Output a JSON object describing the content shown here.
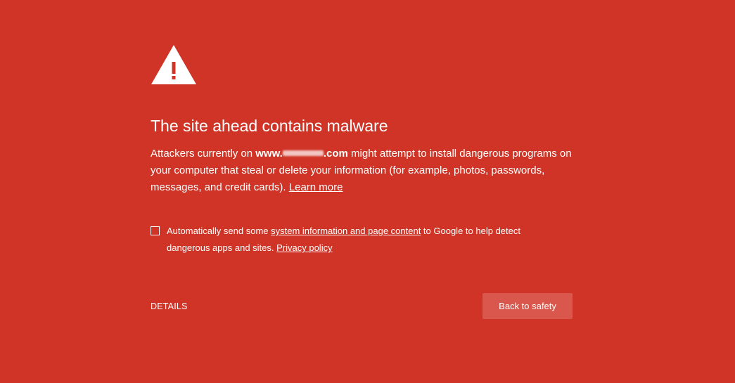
{
  "colors": {
    "background": "#cf3427",
    "button": "#d9574c",
    "text": "#ffffff"
  },
  "icon": "warning-triangle-icon",
  "heading": "The site ahead contains malware",
  "body": {
    "prefix": "Attackers currently on ",
    "domain_start": "www.",
    "domain_end": ".com",
    "suffix": " might attempt to install dangerous programs on your computer that steal or delete your information (for example, photos, passwords, messages, and credit cards). ",
    "learn_more": "Learn more"
  },
  "optin": {
    "checked": false,
    "text_prefix": "Automatically send some ",
    "link_system_info": "system information and page content",
    "text_middle": " to Google to help detect dangerous apps and sites. ",
    "link_privacy": "Privacy policy"
  },
  "details_label": "DETAILS",
  "back_button_label": "Back to safety"
}
